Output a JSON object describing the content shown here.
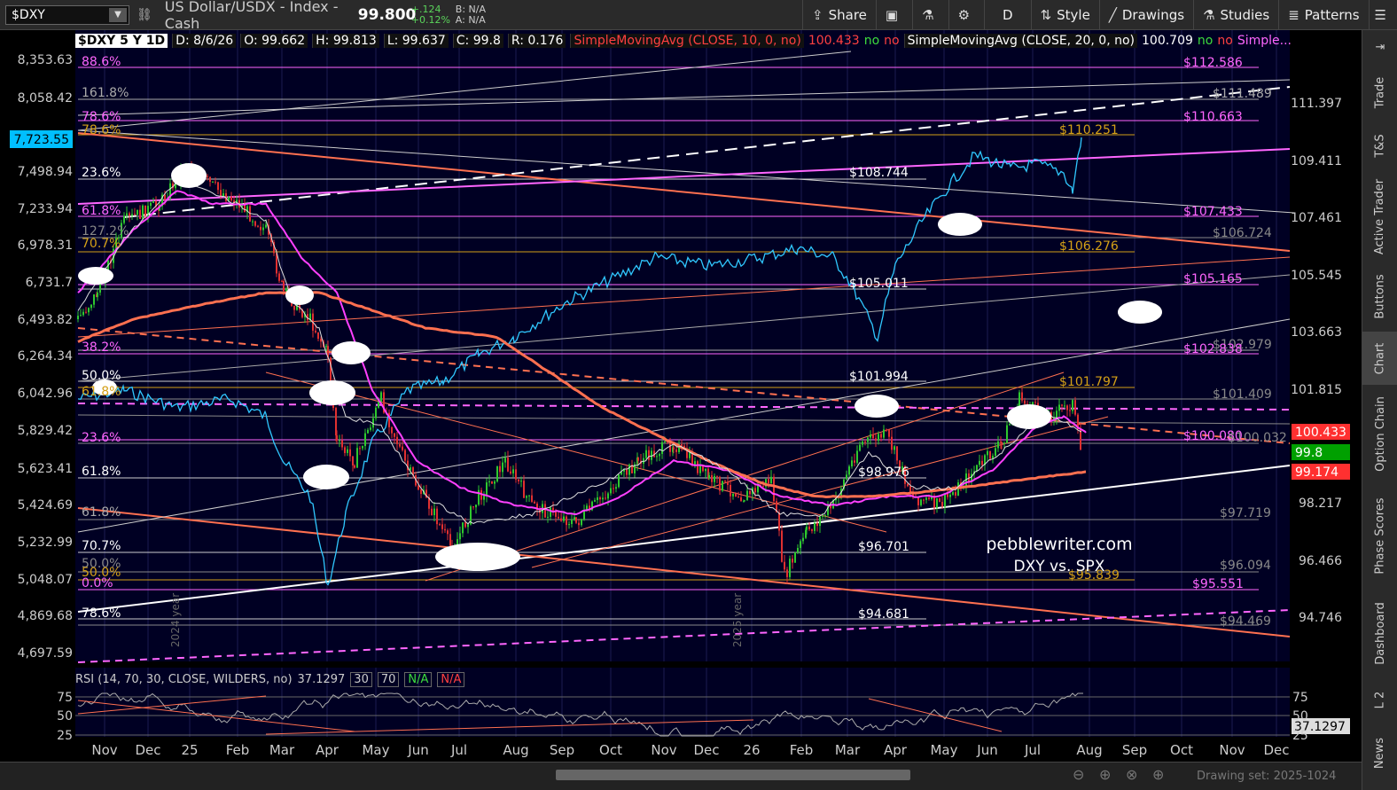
{
  "toolbar": {
    "symbol": "$DXY",
    "description": "US Dollar/USDX - Index - Cash",
    "last": "99.800",
    "change": "+.124",
    "change_pct": "+0.12%",
    "bid": "B: N/A",
    "ask": "A: N/A",
    "buttons": [
      "Share",
      "D",
      "Style",
      "Drawings",
      "Studies",
      "Patterns"
    ]
  },
  "pricebar": {
    "symbol": "$DXY 5 Y 1D",
    "date": "D: 8/6/26",
    "open": "O: 99.662",
    "high": "H: 99.813",
    "low": "L: 99.637",
    "close": "C: 99.8",
    "range": "R: 0.176",
    "sma10": "SimpleMovingAvg (CLOSE, 10, 0, no)",
    "sma10_val": "100.433",
    "sma20": "SimpleMovingAvg (CLOSE, 20, 0, no)",
    "sma20_val": "100.709",
    "no": "no",
    "more": "Simple..."
  },
  "rsi": {
    "label": "RSI (14, 70, 30, CLOSE, WILDERS, no)",
    "value": "37.1297",
    "ob": "30",
    "os": "70",
    "na1": "N/A",
    "na2": "N/A",
    "ticks": [
      "75",
      "50",
      "25"
    ]
  },
  "left_axis": [
    "8,353.63",
    "8,058.42",
    "7,723.55",
    "7,498.94",
    "7,233.94",
    "6,978.31",
    "6,731.7",
    "6,493.82",
    "6,264.34",
    "6,042.96",
    "5,829.42",
    "5,623.41",
    "5,424.69",
    "5,232.99",
    "5,048.07",
    "4,869.68",
    "4,697.59"
  ],
  "right_axis": [
    "111.397",
    "109.411",
    "107.461",
    "105.545",
    "103.663",
    "101.815",
    "98.217",
    "96.466",
    "94.746"
  ],
  "price_tags": [
    "100.433",
    "99.8",
    "99.174"
  ],
  "rsi_tag": "37.1297",
  "x_axis": [
    "Nov",
    "Dec",
    "25",
    "Feb",
    "Mar",
    "Apr",
    "May",
    "Jun",
    "Jul",
    "Aug",
    "Sep",
    "Oct",
    "Nov",
    "Dec",
    "26",
    "Feb",
    "Mar",
    "Apr",
    "May",
    "Jun",
    "Jul",
    "Aug",
    "Sep",
    "Oct",
    "Nov",
    "Dec"
  ],
  "fib_left": [
    "88.6%",
    "161.8%",
    "78.6%",
    "78.6%",
    "23.6%",
    "61.8%",
    "127.2%",
    "70.7%",
    "38.2%",
    "50.0%",
    "61.8%",
    "23.6%",
    "61.8%",
    "61.8%",
    "70.7%",
    "50.0%",
    "50.0%",
    "0.0%",
    "78.6%"
  ],
  "level_labels": [
    "$112.586",
    "$111.489",
    "$110.663",
    "$110.251",
    "$108.744",
    "$107.433",
    "$106.724",
    "$106.276",
    "$105.165",
    "$105.011",
    "$102.979",
    "$102.838",
    "$101.994",
    "$101.797",
    "$101.409",
    "$100.080",
    "$100.032",
    "$98.976",
    "$97.719",
    "$96.701",
    "$96.094",
    "$95.839",
    "$95.551",
    "$94.681",
    "$94.469"
  ],
  "watermark": "pebblewriter.com",
  "subtitle": "DXY vs. SPX",
  "year_2024": "2024 year",
  "year_2025": "2025 year",
  "right_panel": [
    "Trade",
    "T&S",
    "Active Trader",
    "Buttons",
    "Chart",
    "Option Chain",
    "Phase Scores",
    "Dashboard",
    "L 2",
    "News"
  ],
  "drawing_set": "Drawing set: 2025-1024",
  "colors": {
    "bg": "#000023",
    "pink": "#ff66ff",
    "salmon": "#ff7050",
    "gold": "#d4a017",
    "cyan": "#30c8ff",
    "sma": "#ff6464"
  }
}
